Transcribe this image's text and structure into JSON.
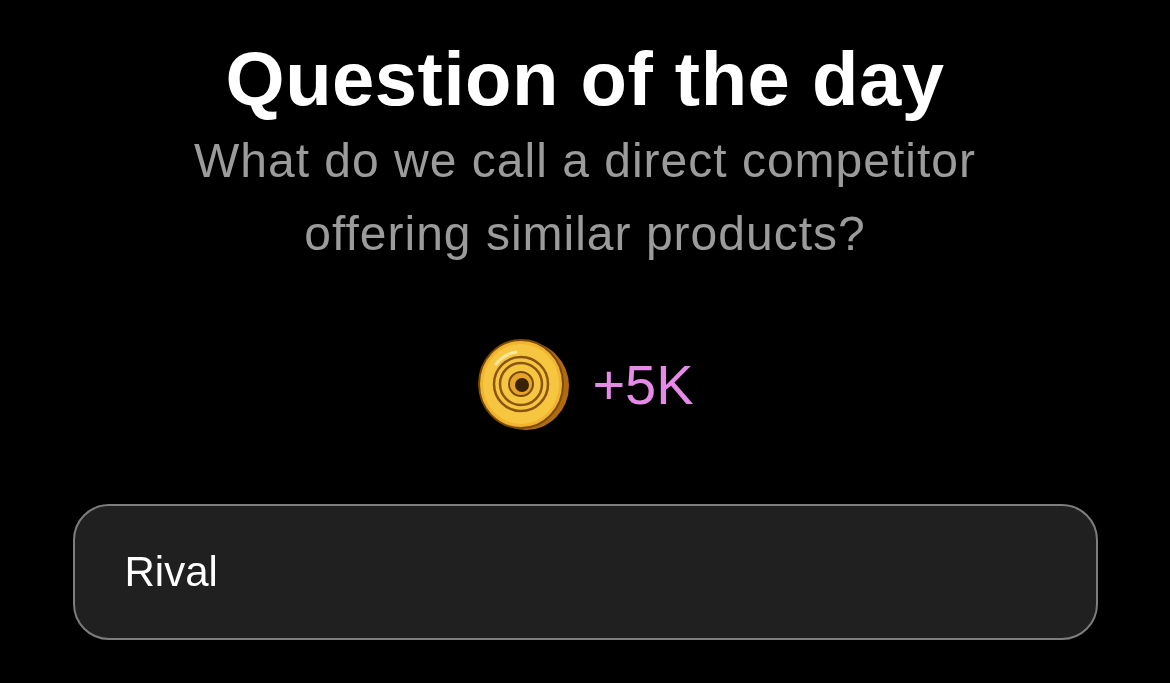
{
  "title": "Question of the day",
  "question": "What do we call a direct competitor offering similar products?",
  "reward": {
    "amount": "+5K"
  },
  "answer": {
    "value": "Rival"
  }
}
